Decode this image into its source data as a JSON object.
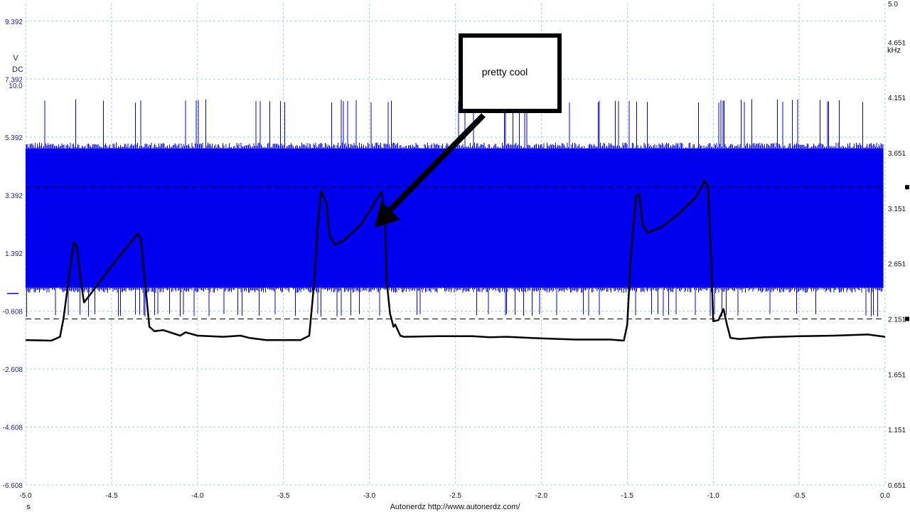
{
  "chart_data": {
    "type": "line",
    "footer": "Autonerdz  http://www.autonerdz.com/",
    "annotation": {
      "text": "pretty cool"
    },
    "x_axis": {
      "unit": "s",
      "range": [
        -5.0,
        0.0
      ],
      "ticks": [
        -5.0,
        -4.5,
        -4.0,
        -3.5,
        -3.0,
        -2.5,
        -2.0,
        -1.5,
        -1.0,
        -0.5,
        0.0
      ],
      "tick_labels": [
        "-5.0",
        "-4.5",
        "-4.0",
        "-3.5",
        "-3.0",
        "-2.5",
        "-2.0",
        "-1.5",
        "-1.0",
        "-0.5",
        "0.0"
      ],
      "grid": true
    },
    "y_left": {
      "unit": "V",
      "coupling": "DC",
      "range": [
        -6.608,
        10.0
      ],
      "top_label": "10.0",
      "ticks": [
        9.392,
        7.392,
        5.392,
        3.392,
        1.392,
        -0.608,
        -2.608,
        -4.608,
        -6.608
      ],
      "tick_labels": [
        "9.392",
        "7.392",
        "5.392",
        "3.392",
        "1.392",
        "-0.608",
        "-2.608",
        "-4.608",
        "-6.608"
      ],
      "grid": true
    },
    "y_right": {
      "unit": "kHz",
      "range": [
        0.651,
        5.0
      ],
      "ticks": [
        5.0,
        4.651,
        4.151,
        3.651,
        3.151,
        2.651,
        2.151,
        1.651,
        1.151,
        0.651
      ],
      "tick_labels": [
        "5.0",
        "4.651",
        "4.151",
        "3.651",
        "3.151",
        "2.651",
        "2.151",
        "1.651",
        "1.151",
        "0.651"
      ],
      "trigger_levels_khz": [
        3.341,
        2.151
      ]
    },
    "colors": {
      "voltage": "#0000ee",
      "frequency": "#000000",
      "grid": "#9fd3e6",
      "axis_text": "#1a1aa0"
    },
    "series": [
      {
        "axis": "left",
        "kind": "envelope",
        "x_range": [
          -5.0,
          -0.01
        ],
        "band_upper": 5.0,
        "band_lower": 0.2,
        "spike_max": 6.7,
        "spike_min": -0.8
      },
      {
        "axis": "right",
        "kind": "line",
        "points": [
          [
            -5.0,
            1.96
          ],
          [
            -4.85,
            1.955
          ],
          [
            -4.8,
            1.99
          ],
          [
            -4.78,
            2.15
          ],
          [
            -4.75,
            2.5
          ],
          [
            -4.72,
            2.84
          ],
          [
            -4.7,
            2.8
          ],
          [
            -4.68,
            2.5
          ],
          [
            -4.66,
            2.3
          ],
          [
            -4.6,
            2.42
          ],
          [
            -4.5,
            2.63
          ],
          [
            -4.4,
            2.82
          ],
          [
            -4.35,
            2.92
          ],
          [
            -4.33,
            2.88
          ],
          [
            -4.3,
            2.4
          ],
          [
            -4.28,
            2.08
          ],
          [
            -4.25,
            2.04
          ],
          [
            -4.2,
            2.05
          ],
          [
            -4.1,
            2.0
          ],
          [
            -4.07,
            2.03
          ],
          [
            -4.0,
            2.0
          ],
          [
            -3.85,
            1.99
          ],
          [
            -3.75,
            2.0
          ],
          [
            -3.7,
            1.98
          ],
          [
            -3.6,
            1.96
          ],
          [
            -3.5,
            1.96
          ],
          [
            -3.4,
            1.96
          ],
          [
            -3.35,
            2.0
          ],
          [
            -3.32,
            2.5
          ],
          [
            -3.3,
            3.0
          ],
          [
            -3.28,
            3.31
          ],
          [
            -3.25,
            3.2
          ],
          [
            -3.23,
            2.9
          ],
          [
            -3.2,
            2.82
          ],
          [
            -3.15,
            2.86
          ],
          [
            -3.05,
            3.0
          ],
          [
            -2.97,
            3.2
          ],
          [
            -2.93,
            3.3
          ],
          [
            -2.91,
            3.1
          ],
          [
            -2.9,
            2.5
          ],
          [
            -2.88,
            2.2
          ],
          [
            -2.86,
            2.08
          ],
          [
            -2.85,
            2.1
          ],
          [
            -2.82,
            2.0
          ],
          [
            -2.8,
            1.99
          ],
          [
            -2.6,
            1.995
          ],
          [
            -2.4,
            1.995
          ],
          [
            -2.3,
            1.985
          ],
          [
            -2.2,
            1.99
          ],
          [
            -2.0,
            1.975
          ],
          [
            -1.8,
            1.965
          ],
          [
            -1.6,
            1.965
          ],
          [
            -1.52,
            1.955
          ],
          [
            -1.5,
            2.1
          ],
          [
            -1.48,
            2.7
          ],
          [
            -1.45,
            3.25
          ],
          [
            -1.43,
            3.28
          ],
          [
            -1.41,
            3.0
          ],
          [
            -1.38,
            2.93
          ],
          [
            -1.3,
            2.98
          ],
          [
            -1.2,
            3.1
          ],
          [
            -1.1,
            3.25
          ],
          [
            -1.05,
            3.4
          ],
          [
            -1.03,
            3.35
          ],
          [
            -1.01,
            2.6
          ],
          [
            -1.0,
            2.13
          ],
          [
            -0.97,
            2.14
          ],
          [
            -0.94,
            2.24
          ],
          [
            -0.92,
            2.1
          ],
          [
            -0.9,
            1.98
          ],
          [
            -0.85,
            1.97
          ],
          [
            -0.7,
            1.985
          ],
          [
            -0.5,
            1.995
          ],
          [
            -0.3,
            2.0
          ],
          [
            -0.1,
            2.01
          ],
          [
            0.0,
            1.99
          ]
        ]
      }
    ]
  }
}
